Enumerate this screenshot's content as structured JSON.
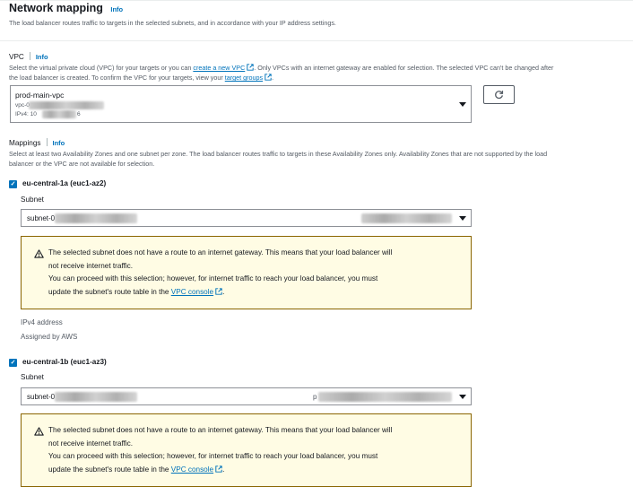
{
  "section": {
    "title": "Network mapping",
    "info": "Info",
    "description": "The load balancer routes traffic to targets in the selected subnets, and in accordance with your IP address settings."
  },
  "vpc": {
    "label": "VPC",
    "info": "Info",
    "desc_part1": "Select the virtual private cloud (VPC) for your targets or you can ",
    "create_link": "create a new VPC",
    "desc_part2": ". Only VPCs with an internet gateway are enabled for selection. The selected VPC can't be changed after",
    "desc_part3": "the load balancer is created. To confirm the VPC for your targets, view your ",
    "target_groups_link": "target groups",
    "desc_part4": ".",
    "selected_name": "prod-main-vpc",
    "selected_id_prefix": "vpc-0",
    "ipv4_prefix": "IPv4: 10",
    "ipv4_suffix": "6"
  },
  "mappings": {
    "label": "Mappings",
    "info": "Info",
    "description_line1": "Select at least two Availability Zones and one subnet per zone. The load balancer routes traffic to targets in these Availability Zones only. Availability Zones that are not supported by the load",
    "description_line2": "balancer or the VPC are not available for selection.",
    "zones": [
      {
        "name": "eu-central-1a (euc1-az2)",
        "checked": true,
        "subnet_label": "Subnet",
        "subnet_prefix": "subnet-0",
        "subnet_suffix": "",
        "warning_line1": "The selected subnet does not have a route to an internet gateway. This means that your load balancer will",
        "warning_line2": "not receive internet traffic.",
        "warning_line3": "You can proceed with this selection; however, for internet traffic to reach your load balancer, you must",
        "warning_line4_prefix": "update the subnet's route table in the ",
        "vpc_console_link": "VPC console",
        "warning_line4_suffix": ".",
        "ipv4_label": "IPv4 address",
        "ipv4_value": "Assigned by AWS"
      },
      {
        "name": "eu-central-1b (euc1-az3)",
        "checked": true,
        "subnet_label": "Subnet",
        "subnet_prefix": "subnet-0",
        "subnet_suffix": "p",
        "warning_line1": "The selected subnet does not have a route to an internet gateway. This means that your load balancer will",
        "warning_line2": "not receive internet traffic.",
        "warning_line3": "You can proceed with this selection; however, for internet traffic to reach your load balancer, you must",
        "warning_line4_prefix": "update the subnet's route table in the ",
        "vpc_console_link": "VPC console",
        "warning_line4_suffix": "."
      }
    ]
  },
  "colors": {
    "link": "#0073bb",
    "warning_bg": "#fffce4",
    "warning_border": "#8a6500",
    "checkbox": "#0073bb"
  },
  "icons": {
    "info": "info-link",
    "external": "external-link-icon",
    "refresh": "refresh-icon",
    "caret": "caret-down-icon",
    "warning": "warning-triangle-icon",
    "check": "check-icon"
  }
}
